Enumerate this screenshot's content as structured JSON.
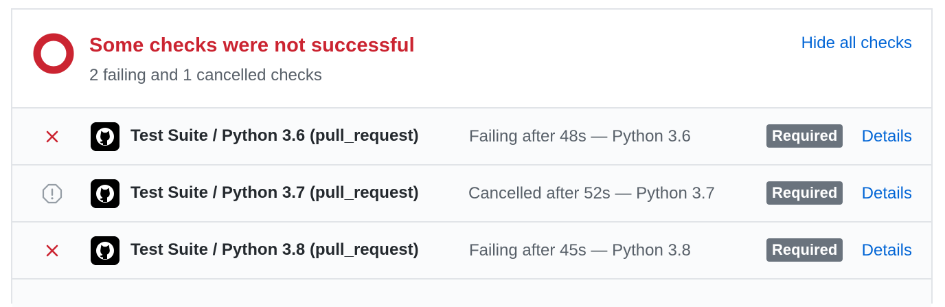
{
  "summary": {
    "title": "Some checks were not successful",
    "subtitle": "2 failing and 1 cancelled checks",
    "toggle_label": "Hide all checks",
    "status_color": "#cb2431"
  },
  "checks": [
    {
      "status": "failing",
      "status_icon": "x-icon",
      "app_icon": "github-icon",
      "name": "Test Suite / Python 3.6 (pull_request)",
      "description": "Failing after 48s — Python 3.6",
      "badge": "Required",
      "link": "Details"
    },
    {
      "status": "cancelled",
      "status_icon": "stop-icon",
      "app_icon": "github-icon",
      "name": "Test Suite / Python 3.7 (pull_request)",
      "description": "Cancelled after 52s — Python 3.7",
      "badge": "Required",
      "link": "Details"
    },
    {
      "status": "failing",
      "status_icon": "x-icon",
      "app_icon": "github-icon",
      "name": "Test Suite / Python 3.8 (pull_request)",
      "description": "Failing after 45s — Python 3.8",
      "badge": "Required",
      "link": "Details"
    }
  ],
  "colors": {
    "fail": "#cb2431",
    "link": "#0366d6",
    "muted": "#586069",
    "badge_bg": "#6a737d"
  }
}
